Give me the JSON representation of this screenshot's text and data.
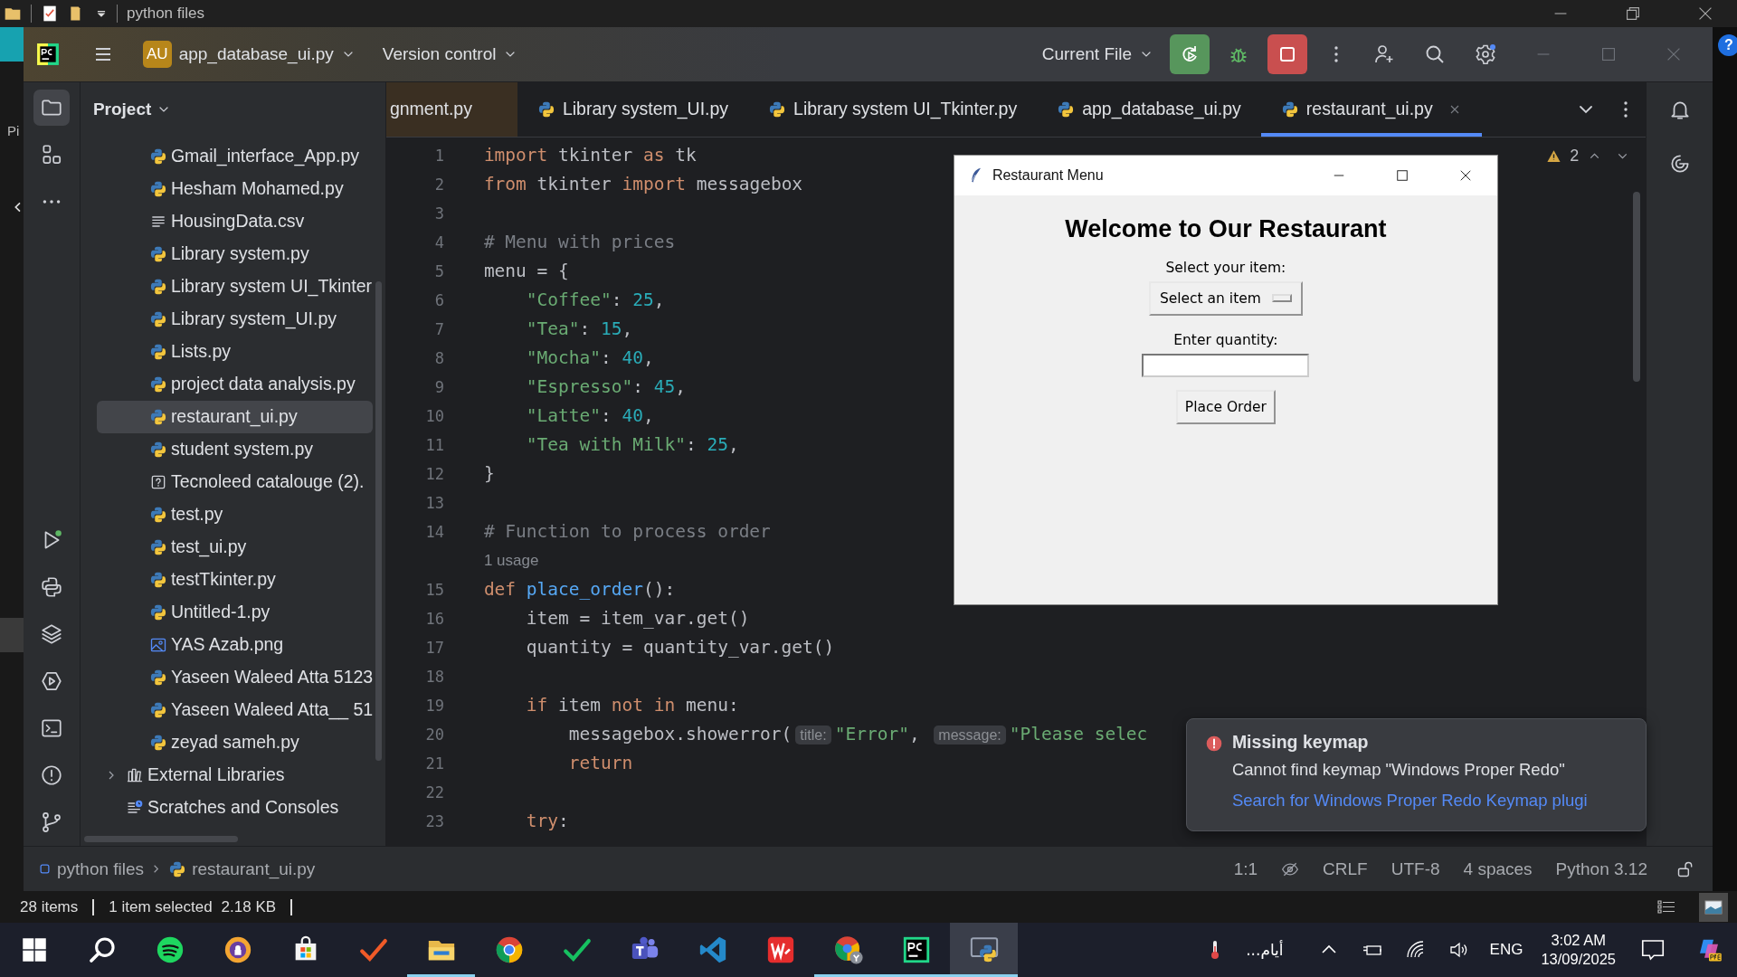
{
  "explorer": {
    "title": "python files",
    "side_text": "Pi",
    "status": {
      "count": "28 items",
      "selection": "1 item selected",
      "size": "2.18 KB"
    }
  },
  "toolbar": {
    "project_badge": "AU",
    "project": "app_database_ui.py",
    "vcs": "Version control",
    "run_config": "Current File"
  },
  "tool_strip_top": [
    {
      "kind": "folder",
      "selected": true
    },
    {
      "kind": "structure",
      "selected": false
    },
    {
      "kind": "more",
      "selected": false
    }
  ],
  "tool_strip_bottom": [
    {
      "kind": "run",
      "selected": false
    },
    {
      "kind": "python",
      "selected": false
    },
    {
      "kind": "layers",
      "selected": false
    },
    {
      "kind": "services",
      "selected": false
    },
    {
      "kind": "terminal",
      "selected": false
    },
    {
      "kind": "problems",
      "selected": false
    },
    {
      "kind": "git",
      "selected": false
    }
  ],
  "project": {
    "title": "Project",
    "items": [
      {
        "name": "Gmail_interface_App.py",
        "kind": "py",
        "selected": false
      },
      {
        "name": "Hesham Mohamed.py",
        "kind": "py",
        "selected": false
      },
      {
        "name": "HousingData.csv",
        "kind": "csv",
        "selected": false
      },
      {
        "name": "Library system.py",
        "kind": "py",
        "selected": false
      },
      {
        "name": "Library system UI_Tkinter",
        "kind": "py",
        "selected": false
      },
      {
        "name": "Library system_UI.py",
        "kind": "py",
        "selected": false
      },
      {
        "name": "Lists.py",
        "kind": "py",
        "selected": false
      },
      {
        "name": "project data analysis.py",
        "kind": "py",
        "selected": false
      },
      {
        "name": "restaurant_ui.py",
        "kind": "py",
        "selected": true
      },
      {
        "name": "student system.py",
        "kind": "py",
        "selected": false
      },
      {
        "name": "Tecnoleed catalouge (2).",
        "kind": "unknown",
        "selected": false
      },
      {
        "name": "test.py",
        "kind": "py",
        "selected": false
      },
      {
        "name": "test_ui.py",
        "kind": "py",
        "selected": false
      },
      {
        "name": "testTkinter.py",
        "kind": "py",
        "selected": false
      },
      {
        "name": "Untitled-1.py",
        "kind": "py",
        "selected": false
      },
      {
        "name": "YAS Azab.png",
        "kind": "png",
        "selected": false
      },
      {
        "name": "Yaseen Waleed Atta 5123",
        "kind": "py",
        "selected": false
      },
      {
        "name": "Yaseen Waleed Atta__ 51",
        "kind": "py",
        "selected": false
      },
      {
        "name": "zeyad sameh.py",
        "kind": "py",
        "selected": false
      }
    ],
    "extra": [
      {
        "name": "External Libraries",
        "kind": "libraries"
      },
      {
        "name": "Scratches and Consoles",
        "kind": "scratches"
      }
    ]
  },
  "tabs": [
    {
      "label": "gnment.py",
      "kind": "clipped",
      "selected": false
    },
    {
      "label": "Library system_UI.py",
      "kind": "python",
      "selected": false
    },
    {
      "label": "Library system UI_Tkinter.py",
      "kind": "python",
      "selected": false
    },
    {
      "label": "app_database_ui.py",
      "kind": "python",
      "selected": false
    },
    {
      "label": "restaurant_ui.py",
      "kind": "python",
      "selected": true
    }
  ],
  "right_strip": [
    {
      "kind": "bell"
    },
    {
      "kind": "ai"
    }
  ],
  "editor": {
    "warnings": "2",
    "lines": [
      {
        "kind": "code",
        "n": "1",
        "tokens": [
          {
            "kind": "keyword",
            "t": "import"
          },
          {
            "kind": "plain",
            "t": " tkinter "
          },
          {
            "kind": "keyword",
            "t": "as"
          },
          {
            "kind": "plain",
            "t": " tk"
          }
        ]
      },
      {
        "kind": "code",
        "n": "2",
        "tokens": [
          {
            "kind": "keyword",
            "t": "from"
          },
          {
            "kind": "plain",
            "t": " tkinter "
          },
          {
            "kind": "keyword",
            "t": "import"
          },
          {
            "kind": "plain",
            "t": " messagebox"
          }
        ]
      },
      {
        "kind": "code",
        "n": "3"
      },
      {
        "kind": "code",
        "n": "4",
        "tokens": [
          {
            "kind": "comment",
            "t": "# Menu with prices"
          }
        ]
      },
      {
        "kind": "code",
        "n": "5",
        "tokens": [
          {
            "kind": "plain",
            "t": "menu = {"
          }
        ]
      },
      {
        "kind": "code",
        "n": "6",
        "tokens": [
          {
            "kind": "string",
            "t": "    \"Coffee\""
          },
          {
            "kind": "plain",
            "t": ": "
          },
          {
            "kind": "number",
            "t": "25"
          },
          {
            "kind": "plain",
            "t": ","
          }
        ]
      },
      {
        "kind": "code",
        "n": "7",
        "tokens": [
          {
            "kind": "string",
            "t": "    \"Tea\""
          },
          {
            "kind": "plain",
            "t": ": "
          },
          {
            "kind": "number",
            "t": "15"
          },
          {
            "kind": "plain",
            "t": ","
          }
        ]
      },
      {
        "kind": "code",
        "n": "8",
        "tokens": [
          {
            "kind": "string",
            "t": "    \"Mocha\""
          },
          {
            "kind": "plain",
            "t": ": "
          },
          {
            "kind": "number",
            "t": "40"
          },
          {
            "kind": "plain",
            "t": ","
          }
        ]
      },
      {
        "kind": "code",
        "n": "9",
        "tokens": [
          {
            "kind": "string",
            "t": "    \"Espresso\""
          },
          {
            "kind": "plain",
            "t": ": "
          },
          {
            "kind": "number",
            "t": "45"
          },
          {
            "kind": "plain",
            "t": ","
          }
        ]
      },
      {
        "kind": "code",
        "n": "10",
        "tokens": [
          {
            "kind": "string",
            "t": "    \"Latte\""
          },
          {
            "kind": "plain",
            "t": ": "
          },
          {
            "kind": "number",
            "t": "40"
          },
          {
            "kind": "plain",
            "t": ","
          }
        ]
      },
      {
        "kind": "code",
        "n": "11",
        "tokens": [
          {
            "kind": "string",
            "t": "    \"Tea with Milk\""
          },
          {
            "kind": "plain",
            "t": ": "
          },
          {
            "kind": "number",
            "t": "25"
          },
          {
            "kind": "plain",
            "t": ","
          }
        ]
      },
      {
        "kind": "code",
        "n": "12",
        "tokens": [
          {
            "kind": "plain",
            "t": "}"
          }
        ]
      },
      {
        "kind": "code",
        "n": "13"
      },
      {
        "kind": "code",
        "n": "14",
        "tokens": [
          {
            "kind": "comment",
            "t": "# Function to process order"
          }
        ]
      },
      {
        "kind": "usage",
        "text": "1 usage"
      },
      {
        "kind": "code",
        "n": "15",
        "tokens": [
          {
            "kind": "keyword",
            "t": "def"
          },
          {
            "kind": "function",
            "t": " place_order"
          },
          {
            "kind": "plain",
            "t": "():"
          }
        ]
      },
      {
        "kind": "code",
        "n": "16",
        "tokens": [
          {
            "kind": "plain",
            "t": "    item = item_var.get()"
          }
        ]
      },
      {
        "kind": "code",
        "n": "17",
        "tokens": [
          {
            "kind": "plain",
            "t": "    quantity = quantity_var.get()"
          }
        ]
      },
      {
        "kind": "code",
        "n": "18"
      },
      {
        "kind": "code",
        "n": "19",
        "tokens": [
          {
            "kind": "keyword",
            "t": "    if"
          },
          {
            "kind": "plain",
            "t": " item "
          },
          {
            "kind": "keyword",
            "t": "not"
          },
          {
            "kind": "keyword",
            "t": " in"
          },
          {
            "kind": "plain",
            "t": " menu:"
          }
        ]
      },
      {
        "kind": "code",
        "n": "20",
        "tokens": [
          {
            "kind": "plain",
            "t": "        messagebox.showerror("
          },
          {
            "kind": "hint",
            "t": "title:"
          },
          {
            "kind": "string",
            "t": "\"Error\""
          },
          {
            "kind": "plain",
            "t": ", "
          },
          {
            "kind": "hint",
            "t": "message:"
          },
          {
            "kind": "string",
            "t": "\"Please selec"
          }
        ]
      },
      {
        "kind": "code",
        "n": "21",
        "tokens": [
          {
            "kind": "keyword",
            "t": "        return"
          }
        ]
      },
      {
        "kind": "code",
        "n": "22"
      },
      {
        "kind": "code",
        "n": "23",
        "tokens": [
          {
            "kind": "keyword",
            "t": "    try"
          },
          {
            "kind": "plain",
            "t": ":"
          }
        ]
      }
    ]
  },
  "tk_window": {
    "title": "Restaurant Menu",
    "heading": "Welcome to Our Restaurant",
    "item_label": "Select your item:",
    "item_value": "Select an item",
    "qty_label": "Enter quantity:",
    "button": "Place Order"
  },
  "notification": {
    "title": "Missing keymap",
    "message": "Cannot find keymap \"Windows Proper Redo\"",
    "link": "Search for Windows Proper Redo Keymap plugi"
  },
  "status_bar": {
    "breadcrumbs": [
      "python files",
      "restaurant_ui.py"
    ],
    "position": "1:1",
    "line_separator": "CRLF",
    "encoding": "UTF-8",
    "indent": "4 spaces",
    "interpreter": "Python 3.12"
  },
  "help": "?",
  "taskbar": {
    "apps": [
      {
        "kind": "start",
        "active": false
      },
      {
        "kind": "search",
        "active": false
      },
      {
        "kind": "spotify",
        "active": false
      },
      {
        "kind": "shield",
        "active": false
      },
      {
        "kind": "store",
        "active": false
      },
      {
        "kind": "orange-check",
        "active": false
      },
      {
        "kind": "files",
        "active": true
      },
      {
        "kind": "chrome",
        "active": false
      },
      {
        "kind": "green-check",
        "active": false
      },
      {
        "kind": "teams",
        "active": false
      },
      {
        "kind": "vscode",
        "active": false
      },
      {
        "kind": "wps",
        "active": false
      },
      {
        "kind": "chrome-profile",
        "active": true
      },
      {
        "kind": "pycharm",
        "active": true
      },
      {
        "kind": "python",
        "active": true
      }
    ],
    "weather": "أيام...",
    "language": "ENG",
    "time": "3:02 AM",
    "date": "13/09/2025"
  }
}
